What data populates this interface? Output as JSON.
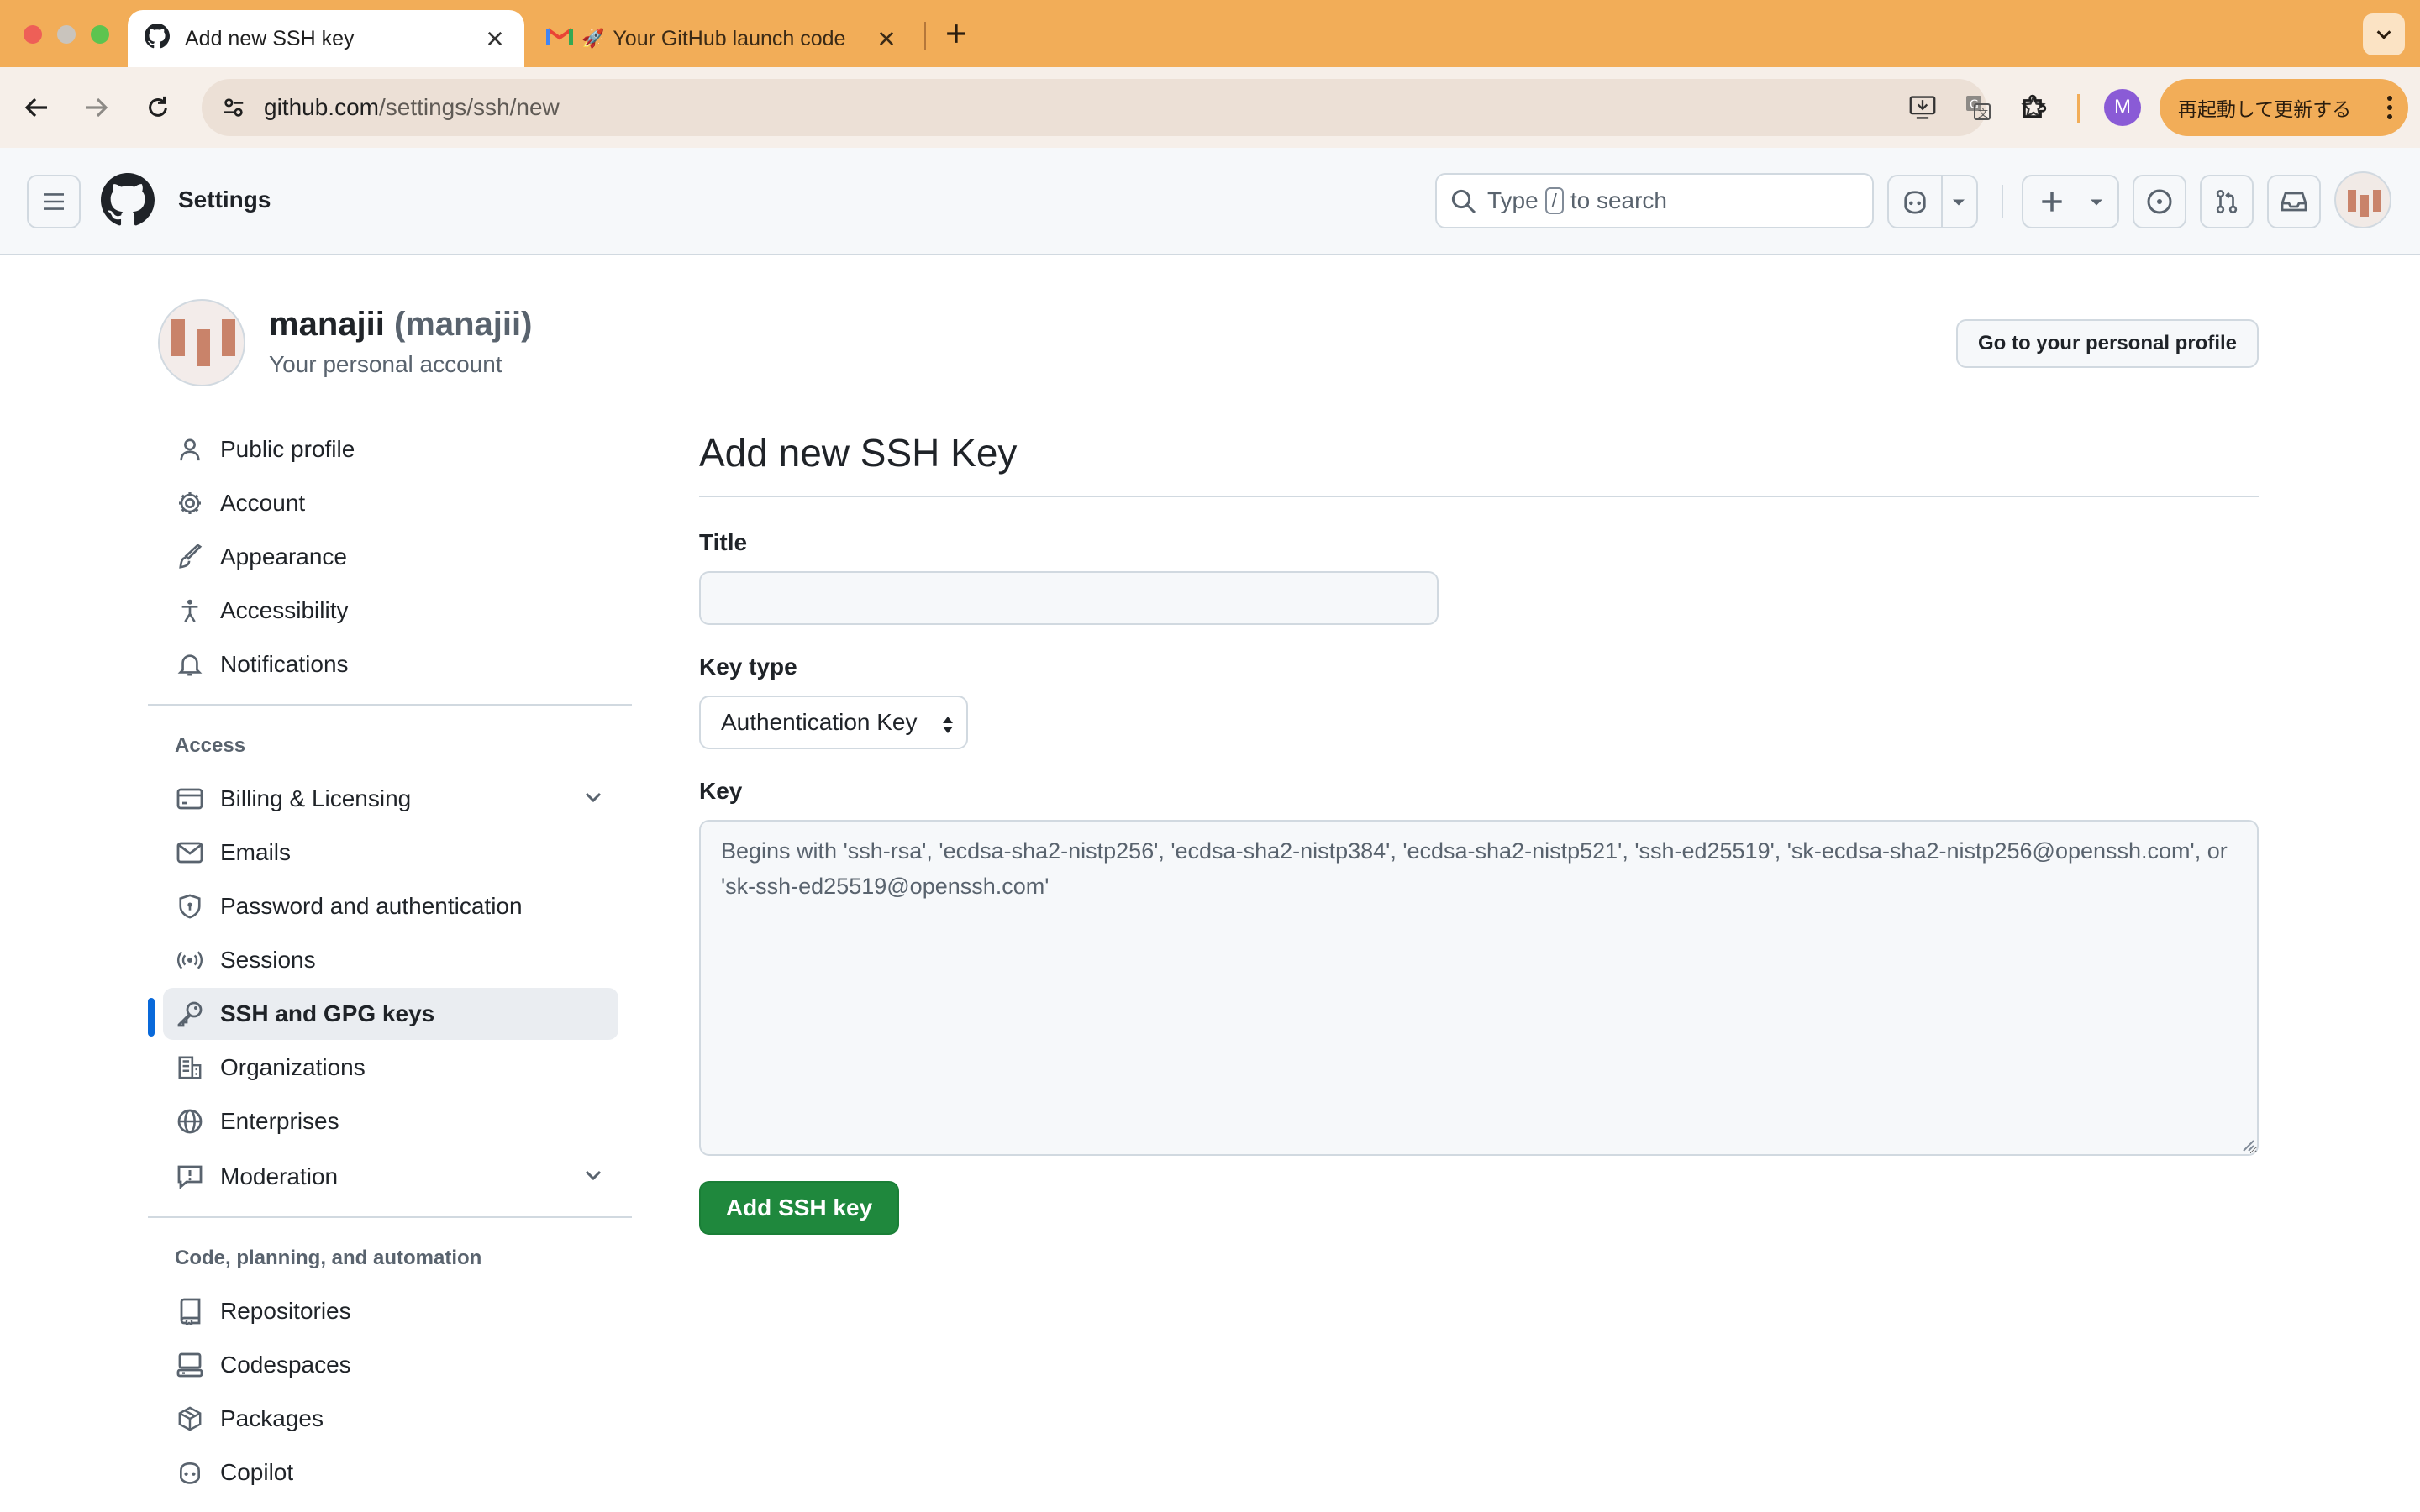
{
  "browser": {
    "tabs": [
      {
        "title": "Add new SSH key",
        "active": true,
        "icon": "github-icon"
      },
      {
        "title": "Your GitHub launch code",
        "active": false,
        "icon": "gmail-icon"
      }
    ],
    "url_host": "github.com",
    "url_path": "/settings/ssh/new",
    "profile_initial": "M",
    "update_label": "再起動して更新する",
    "accent_color": "#f2ad58"
  },
  "header": {
    "title": "Settings",
    "search_prefix": "Type",
    "search_key": "/",
    "search_suffix": "to search"
  },
  "account": {
    "name": "manajii",
    "login": "(manajii)",
    "subtitle": "Your personal account",
    "profile_button": "Go to your personal profile"
  },
  "sidebar": {
    "items_top": [
      {
        "label": "Public profile",
        "icon": "person-icon"
      },
      {
        "label": "Account",
        "icon": "gear-icon"
      },
      {
        "label": "Appearance",
        "icon": "paintbrush-icon"
      },
      {
        "label": "Accessibility",
        "icon": "accessibility-icon"
      },
      {
        "label": "Notifications",
        "icon": "bell-icon"
      }
    ],
    "access_heading": "Access",
    "items_access": [
      {
        "label": "Billing & Licensing",
        "icon": "credit-card-icon",
        "expandable": true
      },
      {
        "label": "Emails",
        "icon": "mail-icon"
      },
      {
        "label": "Password and authentication",
        "icon": "shield-lock-icon"
      },
      {
        "label": "Sessions",
        "icon": "broadcast-icon"
      },
      {
        "label": "SSH and GPG keys",
        "icon": "key-icon",
        "active": true
      },
      {
        "label": "Organizations",
        "icon": "organization-icon"
      },
      {
        "label": "Enterprises",
        "icon": "globe-icon"
      },
      {
        "label": "Moderation",
        "icon": "report-icon",
        "expandable": true
      }
    ],
    "code_heading": "Code, planning, and automation",
    "items_code": [
      {
        "label": "Repositories",
        "icon": "repo-icon"
      },
      {
        "label": "Codespaces",
        "icon": "codespaces-icon"
      },
      {
        "label": "Packages",
        "icon": "package-icon"
      },
      {
        "label": "Copilot",
        "icon": "copilot-icon"
      }
    ]
  },
  "form": {
    "heading": "Add new SSH Key",
    "title_label": "Title",
    "title_value": "",
    "keytype_label": "Key type",
    "keytype_value": "Authentication Key",
    "key_label": "Key",
    "key_placeholder": "Begins with 'ssh-rsa', 'ecdsa-sha2-nistp256', 'ecdsa-sha2-nistp384', 'ecdsa-sha2-nistp521', 'ssh-ed25519', 'sk-ecdsa-sha2-nistp256@openssh.com', or 'sk-ssh-ed25519@openssh.com'",
    "submit_label": "Add SSH key",
    "submit_color": "#1f883d"
  }
}
